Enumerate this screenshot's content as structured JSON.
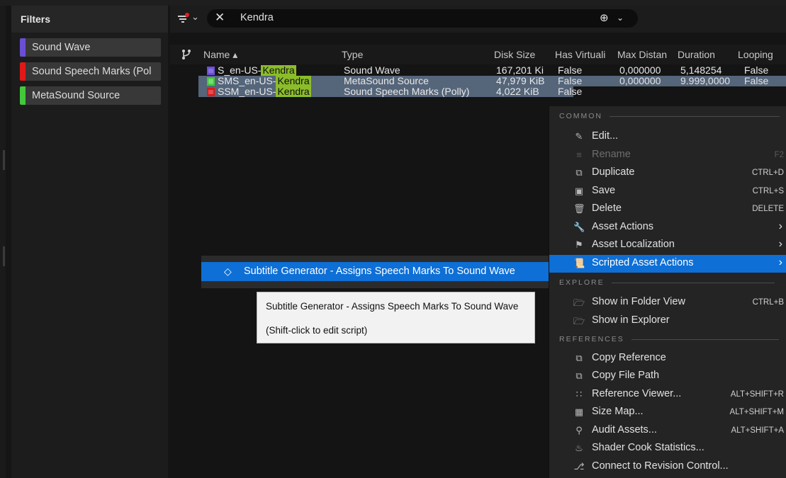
{
  "filters": {
    "title": "Filters",
    "items": [
      {
        "label": "Sound Wave",
        "color": "#6a4fd6"
      },
      {
        "label": "Sound Speech Marks (Pol",
        "color": "#e01818"
      },
      {
        "label": "MetaSound Source",
        "color": "#42c83a"
      }
    ]
  },
  "search": {
    "value": "Kendra",
    "clear_icon": "close-icon",
    "add_icon": "add-filter-icon"
  },
  "columns": [
    "Name ▴",
    "Type",
    "Disk Size",
    "Has Virtuali",
    "Max Distan",
    "Duration",
    "Looping"
  ],
  "rows": [
    {
      "name_prefix": "S_en-US-",
      "name_match": "Kendra",
      "type": "Sound Wave",
      "disk_size": "167,201 Ki",
      "has_virtual": "False",
      "max_distance": "0,000000",
      "duration": "5,148254",
      "looping": "False",
      "icon_color": "#6a4fd6",
      "selected": false
    },
    {
      "name_prefix": "SMS_en-US-",
      "name_match": "Kendra",
      "type": "MetaSound Source",
      "disk_size": "47,979 KiB",
      "has_virtual": "False",
      "max_distance": "0,000000",
      "duration": "9.999,0000",
      "looping": "False",
      "icon_color": "#42c83a",
      "selected": true
    },
    {
      "name_prefix": "SSM_en-US-",
      "name_match": "Kendra",
      "type": "Sound Speech Marks (Polly)",
      "disk_size": "4,022 KiB",
      "has_virtual": "False",
      "max_distance": "",
      "duration": "",
      "looping": "",
      "icon_color": "#e01818",
      "selected": true
    }
  ],
  "script_action": {
    "label": "Subtitle Generator - Assigns Speech Marks To Sound Wave",
    "icon": "script-diamond-icon"
  },
  "tooltip": {
    "line1": "Subtitle Generator - Assigns Speech Marks To Sound Wave",
    "line2": "(Shift-click to edit script)"
  },
  "menu": {
    "sections": {
      "common": "COMMON",
      "explore": "EXPLORE",
      "references": "REFERENCES"
    },
    "items": {
      "edit": {
        "label": "Edit...",
        "icon": "edit-icon"
      },
      "rename": {
        "label": "Rename",
        "shortcut": "F2",
        "icon": "rename-icon"
      },
      "duplicate": {
        "label": "Duplicate",
        "shortcut": "CTRL+D",
        "icon": "duplicate-icon"
      },
      "save": {
        "label": "Save",
        "shortcut": "CTRL+S",
        "icon": "save-icon"
      },
      "delete": {
        "label": "Delete",
        "shortcut": "DELETE",
        "icon": "trash-icon"
      },
      "asset_actions": {
        "label": "Asset Actions",
        "icon": "wrench-icon"
      },
      "asset_localization": {
        "label": "Asset Localization",
        "icon": "flag-icon"
      },
      "scripted_asset_actions": {
        "label": "Scripted Asset Actions",
        "icon": "script-icon"
      },
      "show_folder": {
        "label": "Show in Folder View",
        "shortcut": "CTRL+B",
        "icon": "folder-search-icon"
      },
      "show_explorer": {
        "label": "Show in Explorer",
        "icon": "folder-search-icon"
      },
      "copy_reference": {
        "label": "Copy Reference",
        "icon": "copy-reference-icon"
      },
      "copy_file_path": {
        "label": "Copy File Path",
        "icon": "copy-path-icon"
      },
      "reference_viewer": {
        "label": "Reference Viewer...",
        "shortcut": "ALT+SHIFT+R",
        "icon": "reference-viewer-icon"
      },
      "size_map": {
        "label": "Size Map...",
        "shortcut": "ALT+SHIFT+M",
        "icon": "size-map-icon"
      },
      "audit_assets": {
        "label": "Audit Assets...",
        "shortcut": "ALT+SHIFT+A",
        "icon": "audit-icon"
      },
      "shader_cook": {
        "label": "Shader Cook Statistics...",
        "icon": "shader-icon"
      },
      "revision_control": {
        "label": "Connect to Revision Control...",
        "icon": "branch-icon"
      }
    }
  }
}
